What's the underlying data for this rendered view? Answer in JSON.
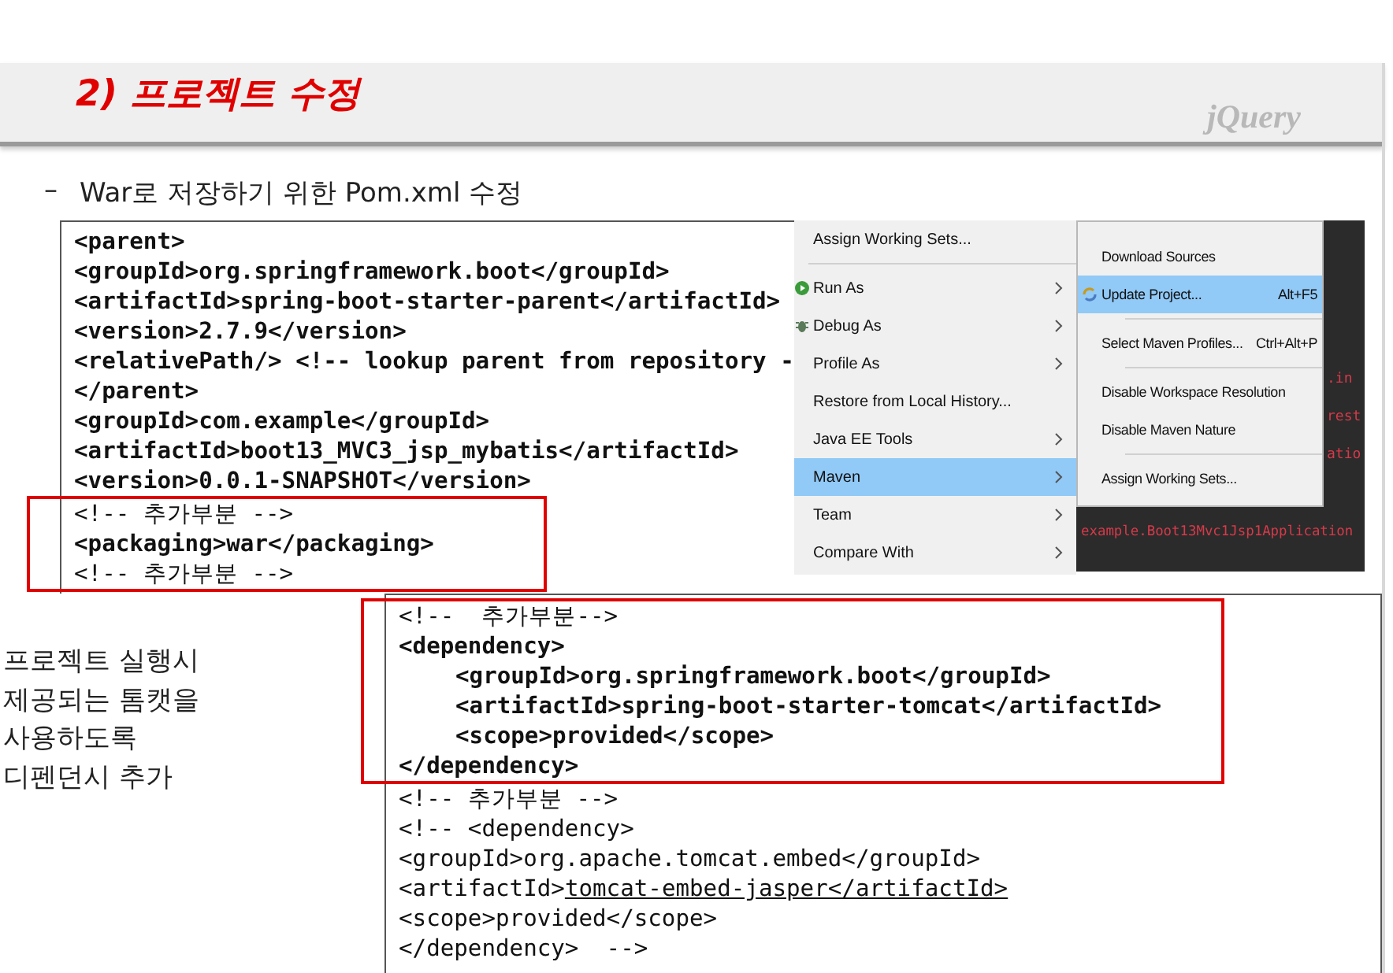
{
  "slide": {
    "title": "2) 프로젝트 수정",
    "logo": "jQuery",
    "subtitle_bullet": "–",
    "subtitle": "War로 저장하기 위한 Pom.xml 수정"
  },
  "pom_code": {
    "sections": [
      {
        "highlighted": false,
        "lines": [
          {
            "text": "<parent>",
            "bold": true
          },
          {
            "text": "<groupId>org.springframework.boot</groupId>",
            "bold": true
          },
          {
            "text": "<artifactId>spring-boot-starter-parent</artifactId>",
            "bold": true
          },
          {
            "text": "<version>2.7.9</version>",
            "bold": true
          },
          {
            "text": "<relativePath/> <!-- lookup parent from repository -",
            "bold": true
          },
          {
            "text": "</parent>",
            "bold": true
          },
          {
            "text": "<groupId>com.example</groupId>",
            "bold": true
          },
          {
            "text": "<artifactId>boot13_MVC3_jsp_mybatis</artifactId>",
            "bold": true
          },
          {
            "text": "<version>0.0.1-SNAPSHOT</version>",
            "bold": true
          }
        ]
      },
      {
        "highlighted": true,
        "lines": [
          {
            "text": "<!-- 추가부분 -->",
            "bold": false
          },
          {
            "text": "<packaging>war</packaging>",
            "bold": true
          },
          {
            "text": "<!-- 추가부분 -->",
            "bold": false
          }
        ]
      }
    ]
  },
  "context_menu": {
    "items": [
      {
        "label": "Assign Working Sets...",
        "submenu": false,
        "selected": false
      },
      {
        "kind": "separator"
      },
      {
        "label": "Run As",
        "submenu": true,
        "selected": false,
        "kind": "run"
      },
      {
        "label": "Debug As",
        "submenu": true,
        "selected": false,
        "kind": "debug"
      },
      {
        "label": "Profile As",
        "submenu": true,
        "selected": false
      },
      {
        "label": "Restore from Local History...",
        "submenu": false,
        "selected": false
      },
      {
        "label": "Java EE Tools",
        "submenu": true,
        "selected": false
      },
      {
        "label": "Maven",
        "submenu": true,
        "selected": true
      },
      {
        "label": "Team",
        "submenu": true,
        "selected": false
      },
      {
        "label": "Compare With",
        "submenu": true,
        "selected": false
      }
    ]
  },
  "maven_submenu": {
    "items": [
      {
        "label": "Download Sources",
        "selected": false
      },
      {
        "label": "Update Project...",
        "shortcut": "Alt+F5",
        "selected": true,
        "kind": "update"
      },
      {
        "kind": "separator"
      },
      {
        "label": "Select Maven Profiles...",
        "shortcut": "Ctrl+Alt+P",
        "selected": false
      },
      {
        "kind": "separator"
      },
      {
        "label": "Disable Workspace Resolution",
        "selected": false
      },
      {
        "label": "Disable Maven Nature",
        "selected": false
      },
      {
        "kind": "separator"
      },
      {
        "label": "Assign Working Sets...",
        "selected": false
      }
    ]
  },
  "console": {
    "fragments": [
      ".in",
      "rest",
      "atio"
    ],
    "line": "example.Boot13Mvc1Jsp1Application"
  },
  "note": {
    "lines": [
      "프로젝트 실행시",
      "제공되는 톰캣을",
      "사용하도록",
      "디펜던시 추가"
    ]
  },
  "dependency_code": {
    "sections": [
      {
        "highlighted": true,
        "lines": [
          {
            "text": "<!--  추가부분-->",
            "bold": false
          },
          {
            "text": "<dependency>",
            "bold": true,
            "children": [
              {
                "text": "<groupId>org.springframework.boot</groupId>",
                "bold": true
              },
              {
                "text": "<artifactId>spring-boot-starter-tomcat</artifactId>",
                "bold": true
              },
              {
                "text": "<scope>provided</scope>",
                "bold": true
              }
            ]
          },
          {
            "text": "</dependency>",
            "bold": true
          }
        ]
      },
      {
        "highlighted": false,
        "lines": [
          {
            "text": "<!-- 추가부분 -->",
            "bold": false
          },
          {
            "text": "<!-- <dependency>",
            "bold": false
          },
          {
            "text": "<groupId>org.apache.tomcat.embed</groupId>",
            "bold": false
          },
          {
            "text": "<artifactId>",
            "bold": false,
            "underlined": "tomcat-embed-jasper</artifactId>"
          },
          {
            "text": "<scope>provided</scope>",
            "bold": false
          },
          {
            "text": "</dependency>  -->",
            "bold": false
          }
        ]
      }
    ]
  }
}
